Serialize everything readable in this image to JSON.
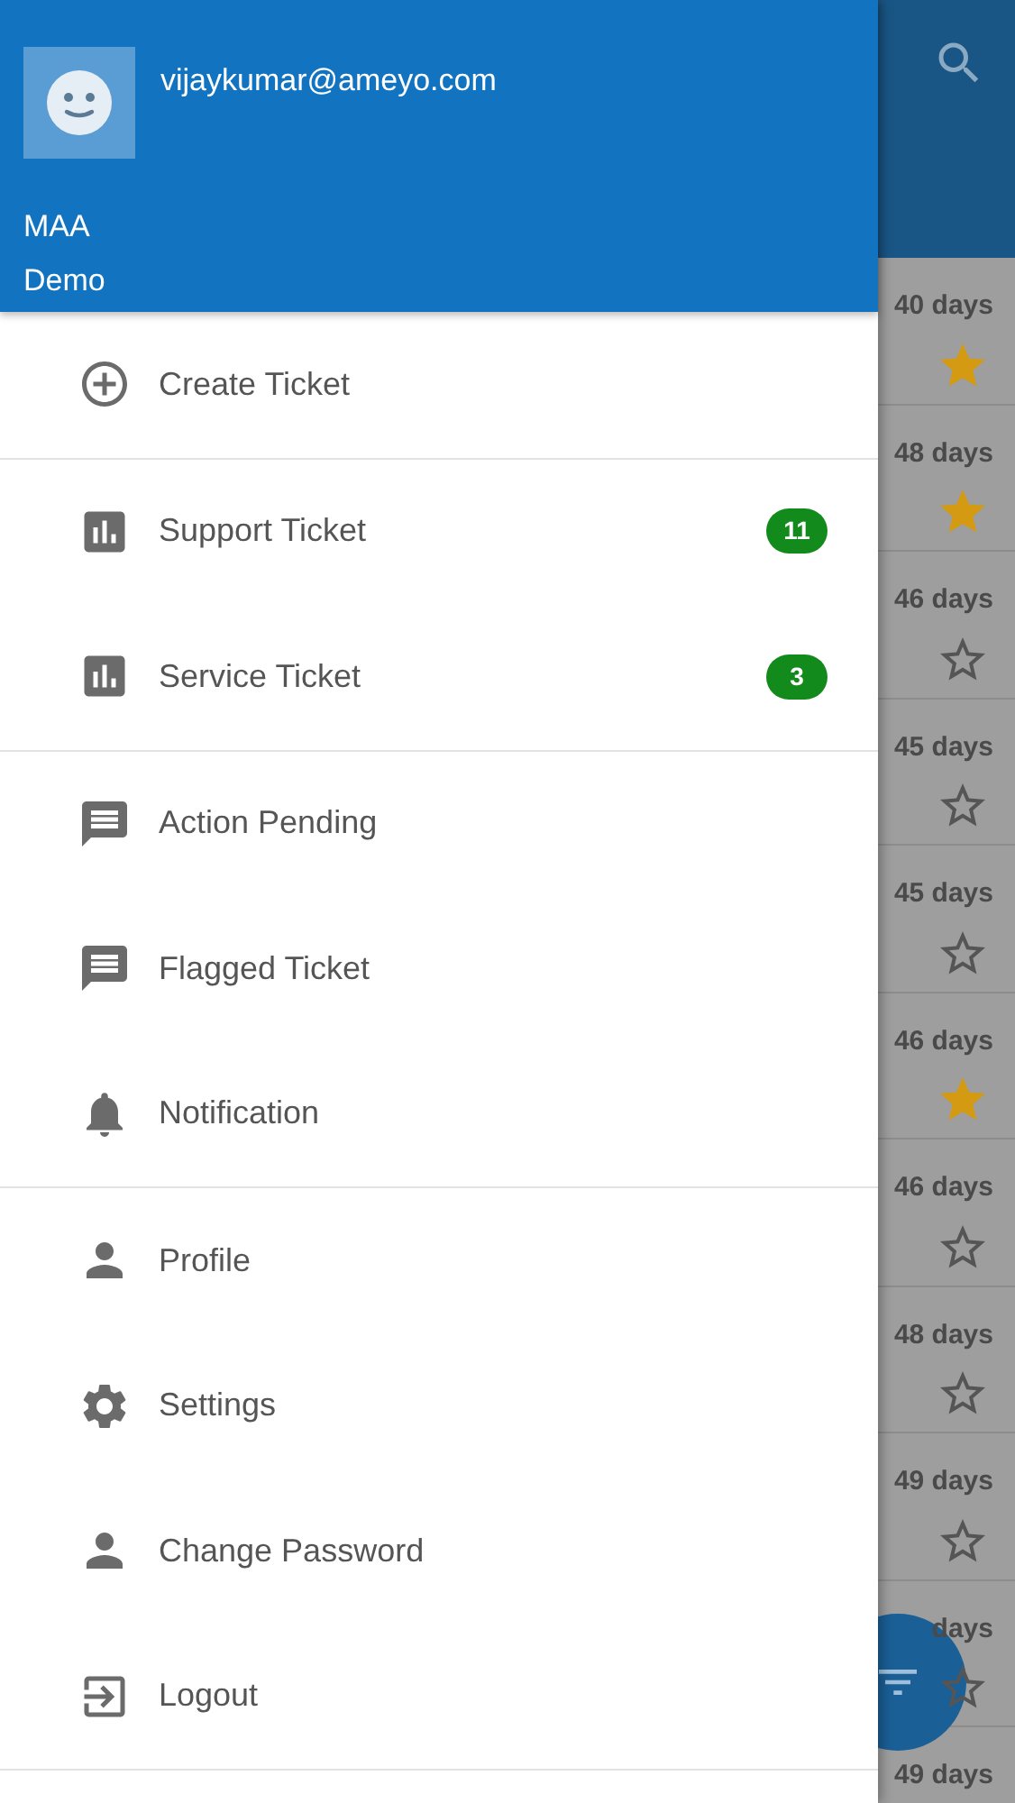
{
  "drawer": {
    "header": {
      "email": "vijaykumar@ameyo.com",
      "lines": [
        "MAA",
        "Demo"
      ]
    },
    "groups": [
      {
        "items": [
          {
            "kind": "add",
            "label": "Create Ticket"
          }
        ]
      },
      {
        "items": [
          {
            "kind": "chart",
            "label": "Support Ticket",
            "badge": "11"
          },
          {
            "kind": "chart",
            "label": "Service Ticket",
            "badge": "3"
          }
        ]
      },
      {
        "items": [
          {
            "kind": "message",
            "label": "Action Pending"
          },
          {
            "kind": "message",
            "label": "Flagged Ticket"
          },
          {
            "kind": "bell",
            "label": "Notification"
          }
        ]
      },
      {
        "items": [
          {
            "kind": "person",
            "label": "Profile"
          },
          {
            "kind": "gear",
            "label": "Settings"
          },
          {
            "kind": "person",
            "label": "Change Password"
          },
          {
            "kind": "logout",
            "label": "Logout"
          }
        ]
      }
    ]
  },
  "ticket_list": [
    {
      "age": "40 days",
      "starred": true
    },
    {
      "age": "48 days",
      "starred": true
    },
    {
      "age": "46 days",
      "starred": false
    },
    {
      "age": "45 days",
      "starred": false
    },
    {
      "age": "45 days",
      "starred": false
    },
    {
      "age": "46 days",
      "starred": true
    },
    {
      "age": "46 days",
      "starred": false
    },
    {
      "age": "48 days",
      "starred": false
    },
    {
      "age": "49 days",
      "starred": false
    },
    {
      "age": "days",
      "starred": false
    },
    {
      "age": "49 days"
    }
  ]
}
